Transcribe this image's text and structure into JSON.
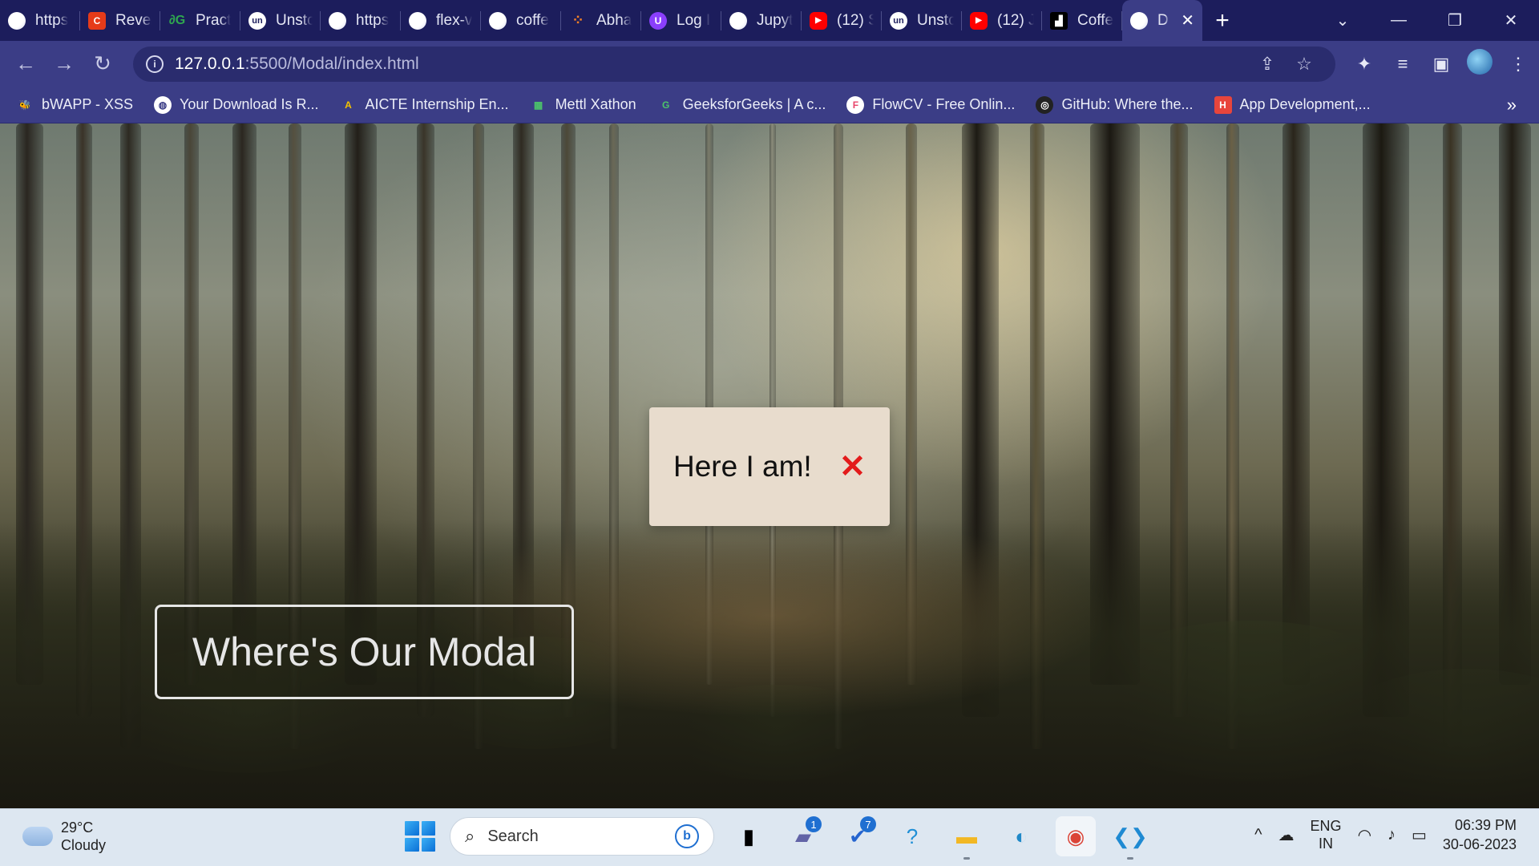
{
  "browser": {
    "tabs": [
      {
        "label": "https",
        "icon": "globe-icon",
        "kind": "globe"
      },
      {
        "label": "Revei",
        "icon": "orange-c-icon",
        "kind": "red"
      },
      {
        "label": "Pract",
        "icon": "geeksforgeeks-icon",
        "kind": "green"
      },
      {
        "label": "Unstc",
        "icon": "unstop-icon",
        "kind": "un"
      },
      {
        "label": "https",
        "icon": "globe-icon",
        "kind": "globe"
      },
      {
        "label": "flex-v",
        "icon": "globe-icon",
        "kind": "globe"
      },
      {
        "label": "coffe",
        "icon": "globe-icon",
        "kind": "globe"
      },
      {
        "label": "Abha",
        "icon": "orange-dots-icon",
        "kind": "orange"
      },
      {
        "label": "Log I",
        "icon": "purple-shield-icon",
        "kind": "purple"
      },
      {
        "label": "Jupyt",
        "icon": "globe-icon",
        "kind": "globe"
      },
      {
        "label": "(12) S",
        "icon": "youtube-icon",
        "kind": "yt"
      },
      {
        "label": "Unstc",
        "icon": "unstop-icon",
        "kind": "un"
      },
      {
        "label": "(12) J",
        "icon": "youtube-icon",
        "kind": "yt"
      },
      {
        "label": "Coffe",
        "icon": "black-app-icon",
        "kind": "black"
      },
      {
        "label": "D",
        "icon": "globe-icon",
        "kind": "globe",
        "active": true
      }
    ],
    "address": {
      "url_host": "127.0.0.1",
      "url_rest": ":5500/Modal/index.html"
    },
    "bookmarks": [
      {
        "label": "bWAPP - XSS",
        "icon": "bee-icon"
      },
      {
        "label": "Your Download Is R...",
        "icon": "globe-icon"
      },
      {
        "label": "AICTE Internship En...",
        "icon": "aicte-icon"
      },
      {
        "label": "Mettl Xathon",
        "icon": "chart-icon"
      },
      {
        "label": "GeeksforGeeks | A c...",
        "icon": "geeksforgeeks-icon"
      },
      {
        "label": "FlowCV - Free Onlin...",
        "icon": "flowcv-icon"
      },
      {
        "label": "GitHub: Where the...",
        "icon": "github-icon"
      },
      {
        "label": "App Development,...",
        "icon": "h-icon"
      }
    ]
  },
  "page": {
    "modal": {
      "text": "Here I am!",
      "close_glyph": "✕"
    },
    "open_button_label": "Where's Our Modal",
    "colors": {
      "modal_bg": "#e8dccd",
      "close_red": "#e31b1b",
      "button_border": "#e6e6e6"
    }
  },
  "taskbar": {
    "weather_temp": "29°C",
    "weather_desc": "Cloudy",
    "search_placeholder": "Search",
    "chat_badge": "1",
    "todo_badge": "7",
    "lang_top": "ENG",
    "lang_bottom": "IN",
    "time": "06:39 PM",
    "date": "30-06-2023"
  }
}
